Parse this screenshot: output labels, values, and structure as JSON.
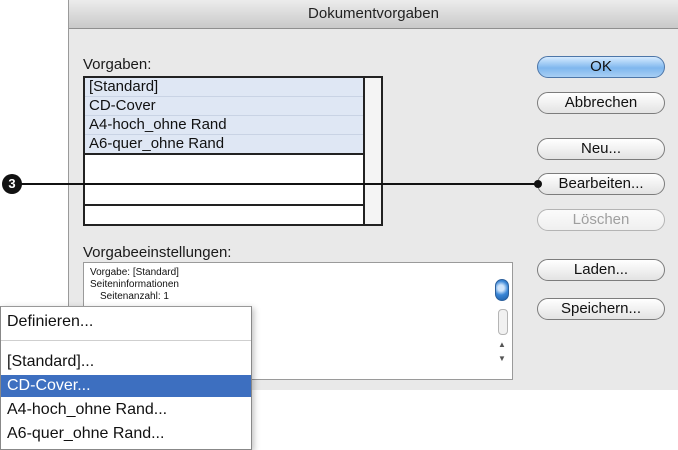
{
  "dialog": {
    "title": "Dokumentvorgaben",
    "presets_label": "Vorgaben:",
    "presets": [
      "[Standard]",
      "CD-Cover",
      "A4-hoch_ohne Rand",
      "A6-quer_ohne Rand"
    ],
    "settings_label": "Vorgabeeinstellungen:",
    "settings_lines": [
      "Vorgabe: [Standard]",
      "Seiteninformationen",
      "Seitenanzahl: 1"
    ],
    "buttons": {
      "ok": "OK",
      "cancel": "Abbrechen",
      "new": "Neu...",
      "edit": "Bearbeiten...",
      "delete": "Löschen",
      "load": "Laden...",
      "save": "Speichern..."
    }
  },
  "callout": {
    "number": "3"
  },
  "popup_menu": {
    "items": [
      "Definieren...",
      "[Standard]...",
      "CD-Cover...",
      "A4-hoch_ohne Rand...",
      "A6-quer_ohne Rand..."
    ],
    "selected": "CD-Cover..."
  },
  "colors": {
    "selection": "#3d6fc0",
    "default_button": "#7fb7ee",
    "list_highlight": "#dfe7f4"
  }
}
